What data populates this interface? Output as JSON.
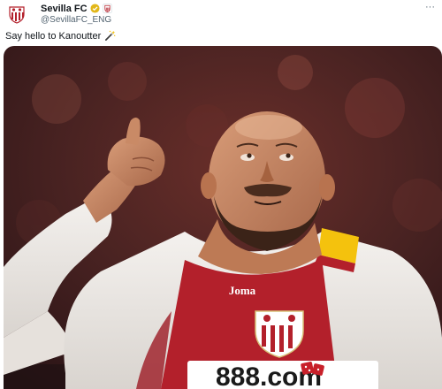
{
  "tweet": {
    "author": {
      "display_name": "Sevilla FC",
      "handle": "@SevillaFC_ENG",
      "verified_badge": "gold-check-badge",
      "affiliate_badge": "sevilla-crest-badge"
    },
    "more_label": "···",
    "text": "Say hello to Kanoutter",
    "text_emoji": "magic-wand-emoji"
  },
  "media": {
    "description_icon": "photo",
    "shirt_sponsor": "Joma",
    "chest_sponsor": "888.com"
  },
  "colors": {
    "brand_red": "#b3202b",
    "verified_gold": "#e2b719",
    "handle_gray": "#536471",
    "text_dark": "#0f1419"
  }
}
